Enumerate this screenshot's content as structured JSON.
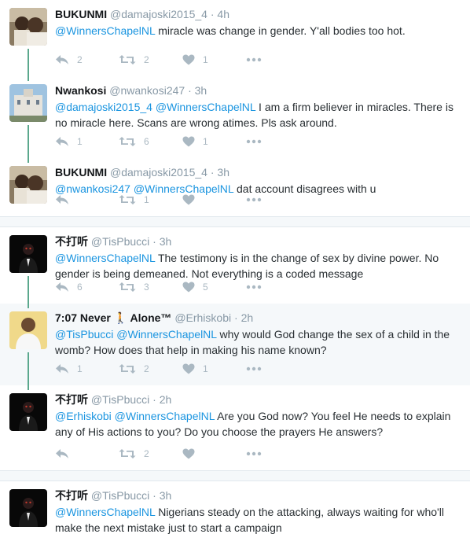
{
  "groups": [
    {
      "tweets": [
        {
          "name": "BUKUNMI",
          "handle": "@damajoski2015_4",
          "time": "4h",
          "mentions": "@WinnersChapelNL",
          "text": " miracle was change in gender.  Y'all bodies too hot.",
          "replies": "2",
          "retweets": "2",
          "likes": "1",
          "avatar": "couple-photo"
        },
        {
          "name": "Nwankosi",
          "handle": "@nwankosi247",
          "time": "3h",
          "mentions": "@damajoski2015_4 @WinnersChapelNL",
          "text": "  I am a firm believer in miracles. There is no miracle here. Scans are wrong atimes. Pls ask around.",
          "replies": "1",
          "retweets": "6",
          "likes": "1",
          "avatar": "building-photo"
        },
        {
          "name": "BUKUNMI",
          "handle": "@damajoski2015_4",
          "time": "3h",
          "mentions": "@nwankosi247 @WinnersChapelNL",
          "text": " dat account disagrees with u",
          "replies": "",
          "retweets": "1",
          "likes": "",
          "avatar": "couple-photo"
        }
      ]
    },
    {
      "tweets": [
        {
          "name": "不打听",
          "handle": "@TisPbucci",
          "time": "3h",
          "mentions": "@WinnersChapelNL",
          "text": " The testimony is in the change of sex by divine power. No gender is being demeaned. Not everything is a coded message",
          "replies": "6",
          "retweets": "3",
          "likes": "5",
          "avatar": "dark-figure-photo"
        },
        {
          "name": "7:07 Never 🚶 Alone™",
          "handle": "@Erhiskobi",
          "time": "2h",
          "mentions": "@TisPbucci @WinnersChapelNL",
          "text": " why would God change the sex of a child in the womb? How does that help in making his name known?",
          "replies": "1",
          "retweets": "2",
          "likes": "1",
          "avatar": "man-white-shirt-photo"
        },
        {
          "name": "不打听",
          "handle": "@TisPbucci",
          "time": "2h",
          "mentions": "@Erhiskobi @WinnersChapelNL",
          "text": " Are you God now? You feel He needs to explain any of His actions to you? Do you choose the prayers He answers?",
          "replies": "",
          "retweets": "2",
          "likes": "",
          "avatar": "dark-figure-photo"
        }
      ]
    },
    {
      "tweets": [
        {
          "name": "不打听",
          "handle": "@TisPbucci",
          "time": "3h",
          "mentions": "@WinnersChapelNL",
          "text": " Nigerians steady on the attacking, always waiting for who'll make the next mistake just to start a campaign",
          "replies": "",
          "retweets": "",
          "likes": "",
          "avatar": "dark-figure-photo"
        }
      ]
    }
  ],
  "ui": {
    "dot": "·",
    "more_icon": "•••"
  },
  "colors": {
    "mention": "#1b95e0",
    "thread_line": "#5ba88d",
    "action_gray": "#aab8c2"
  }
}
